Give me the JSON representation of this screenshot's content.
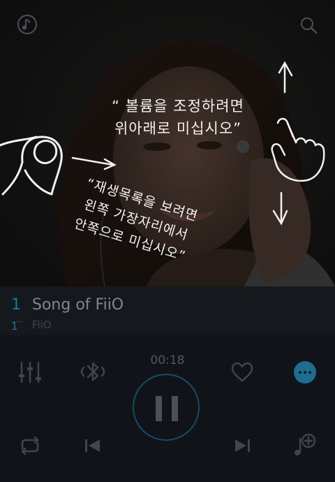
{
  "overlay": {
    "volume_hint": [
      "“ 볼륨을 조정하려면",
      "위아래로 미십시오”"
    ],
    "playlist_hint": [
      "“재생목록을 보려면",
      "왼쪽 가장자리에서",
      "안쪽으로 미십시오”"
    ]
  },
  "track": {
    "current_number": "1",
    "total_number": "1",
    "title": "Song of FiiO",
    "artist": "FiiO"
  },
  "player": {
    "elapsed_time": "00:18"
  },
  "colors": {
    "accent": "#1d6d93",
    "track_number": "#1878a3",
    "overlay_text": "#f2f2f2"
  },
  "icons": {
    "top_left": "music-note-icon",
    "top_right": "search-icon",
    "equalizer": "equalizer-icon",
    "bluetooth": "bluetooth-icon",
    "favorite": "heart-icon",
    "more": "more-icon",
    "play_pause": "pause-icon",
    "repeat": "repeat-icon",
    "previous": "skip-previous-icon",
    "next": "skip-next-icon",
    "add_to_playlist": "add-to-playlist-icon"
  }
}
